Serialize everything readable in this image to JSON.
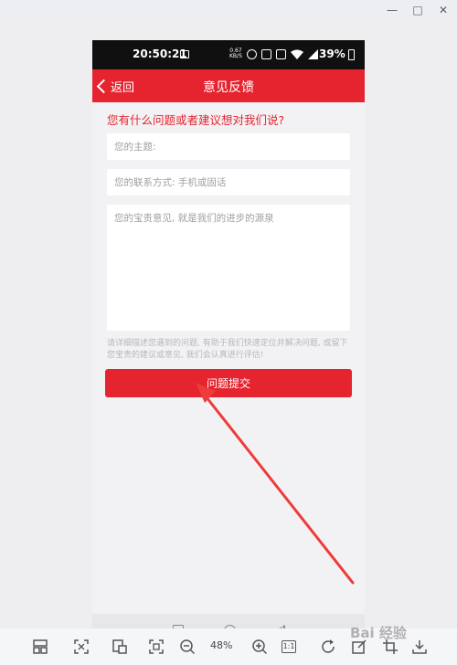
{
  "window": {
    "controls": {
      "minimize": "—",
      "maximize": "□",
      "close": "✕"
    }
  },
  "status_bar": {
    "time": "20:50:21",
    "network_speed": "0.67",
    "network_unit": "KB/S",
    "battery": "39%"
  },
  "app_bar": {
    "back_label": "返回",
    "title": "意见反馈"
  },
  "form": {
    "question": "您有什么问题或者建议想对我们说?",
    "subject_placeholder": "您的主题:",
    "contact_placeholder": "您的联系方式: 手机或固话",
    "feedback_placeholder": "您的宝贵意见, 就是我们的进步的源泉",
    "hint": "请详细描述您遇到的问题, 有助于我们快速定位并解决问题, 或留下您宝贵的建议或意见, 我们会认真进行评估!",
    "submit_label": "问题提交"
  },
  "viewer_toolbar": {
    "zoom": "48%",
    "one_to_one": "1:1"
  },
  "watermark": "Bai 经验",
  "colors": {
    "accent": "#e5242f",
    "status_bar": "#101010"
  }
}
